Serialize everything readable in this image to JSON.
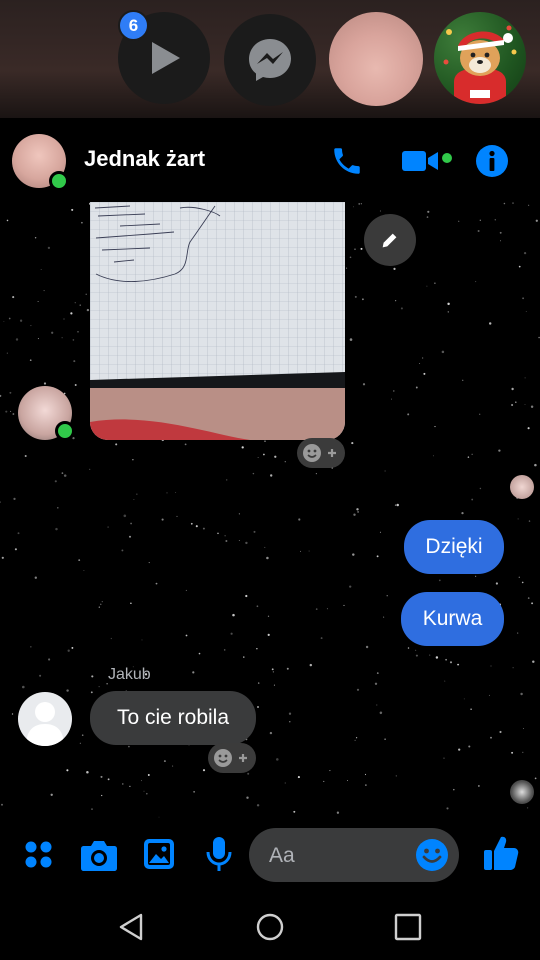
{
  "chat_heads": {
    "unread_badge": "6"
  },
  "conversation": {
    "title": "Jednak żart"
  },
  "messages": {
    "outgoing": [
      "Dzięki",
      "Kurwa"
    ],
    "incoming_sender": "Jakub",
    "incoming_text": "To cie robila"
  },
  "composer": {
    "placeholder": "Aa"
  },
  "colors": {
    "accent": "#0084ff",
    "outgoing_bubble": "#2f6ee0",
    "incoming_bubble": "#3a3b3c",
    "online": "#31c94a"
  },
  "icons": {
    "header": [
      "phone-icon",
      "video-call-icon",
      "info-icon"
    ],
    "composer": [
      "apps-icon",
      "camera-icon",
      "gallery-icon",
      "microphone-icon",
      "emoji-icon",
      "thumbs-up-icon"
    ],
    "nav": [
      "back-icon",
      "home-icon",
      "recents-icon"
    ]
  }
}
